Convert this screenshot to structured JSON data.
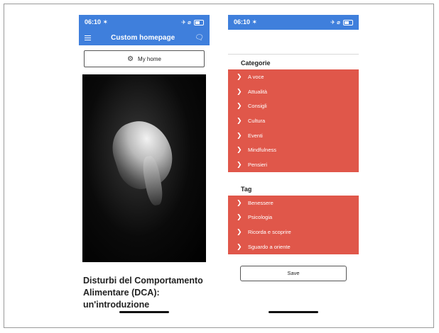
{
  "left_phone": {
    "status": {
      "time": "06:10 ✶",
      "icons": "✈ ⌀"
    },
    "navbar": {
      "title": "Custom homepage"
    },
    "myhome_button": {
      "label": "My home"
    },
    "article": {
      "title": "Disturbi del Comportamento Alimentare (DCA): un'introduzione"
    }
  },
  "right_phone": {
    "status": {
      "time": "06:10 ✶",
      "icons": "✈ ⌀"
    },
    "categories": {
      "title": "Categorie",
      "items": [
        "A voce",
        "Attualità",
        "Consigli",
        "Cultura",
        "Eventi",
        "Mindfulness",
        "Pensieri"
      ]
    },
    "tags": {
      "title": "Tag",
      "items": [
        "Benessere",
        "Psicologia",
        "Ricorda e scoprire",
        "Sguardo a oriente"
      ]
    },
    "save_button": {
      "label": "Save"
    }
  },
  "colors": {
    "header_blue": "#3f7fdc",
    "menu_red": "#e0574a"
  }
}
